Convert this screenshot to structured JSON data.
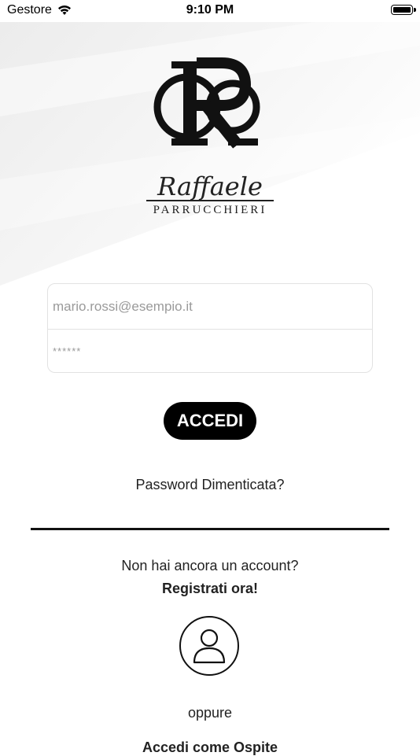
{
  "status_bar": {
    "carrier": "Gestore",
    "time": "9:10 PM",
    "wifi_icon": "wifi-icon",
    "battery_icon": "battery-icon"
  },
  "logo": {
    "monogram": "RR",
    "script": "Raffaele",
    "subtitle": "PARRUCCHIERI"
  },
  "form": {
    "email_value": "mario.rossi@esempio.it",
    "password_value": "******",
    "login_button": "ACCEDI",
    "forgot_password": "Password Dimenticata?"
  },
  "register": {
    "prompt": "Non hai ancora un account?",
    "link": "Registrati ora!"
  },
  "guest": {
    "icon": "user-icon",
    "or_label": "oppure",
    "cut_text": "Accedi come Ospite"
  },
  "colors": {
    "accent": "#000000",
    "background": "#ffffff",
    "hero_gradient": "#ececec",
    "border": "#e2e2e2"
  }
}
